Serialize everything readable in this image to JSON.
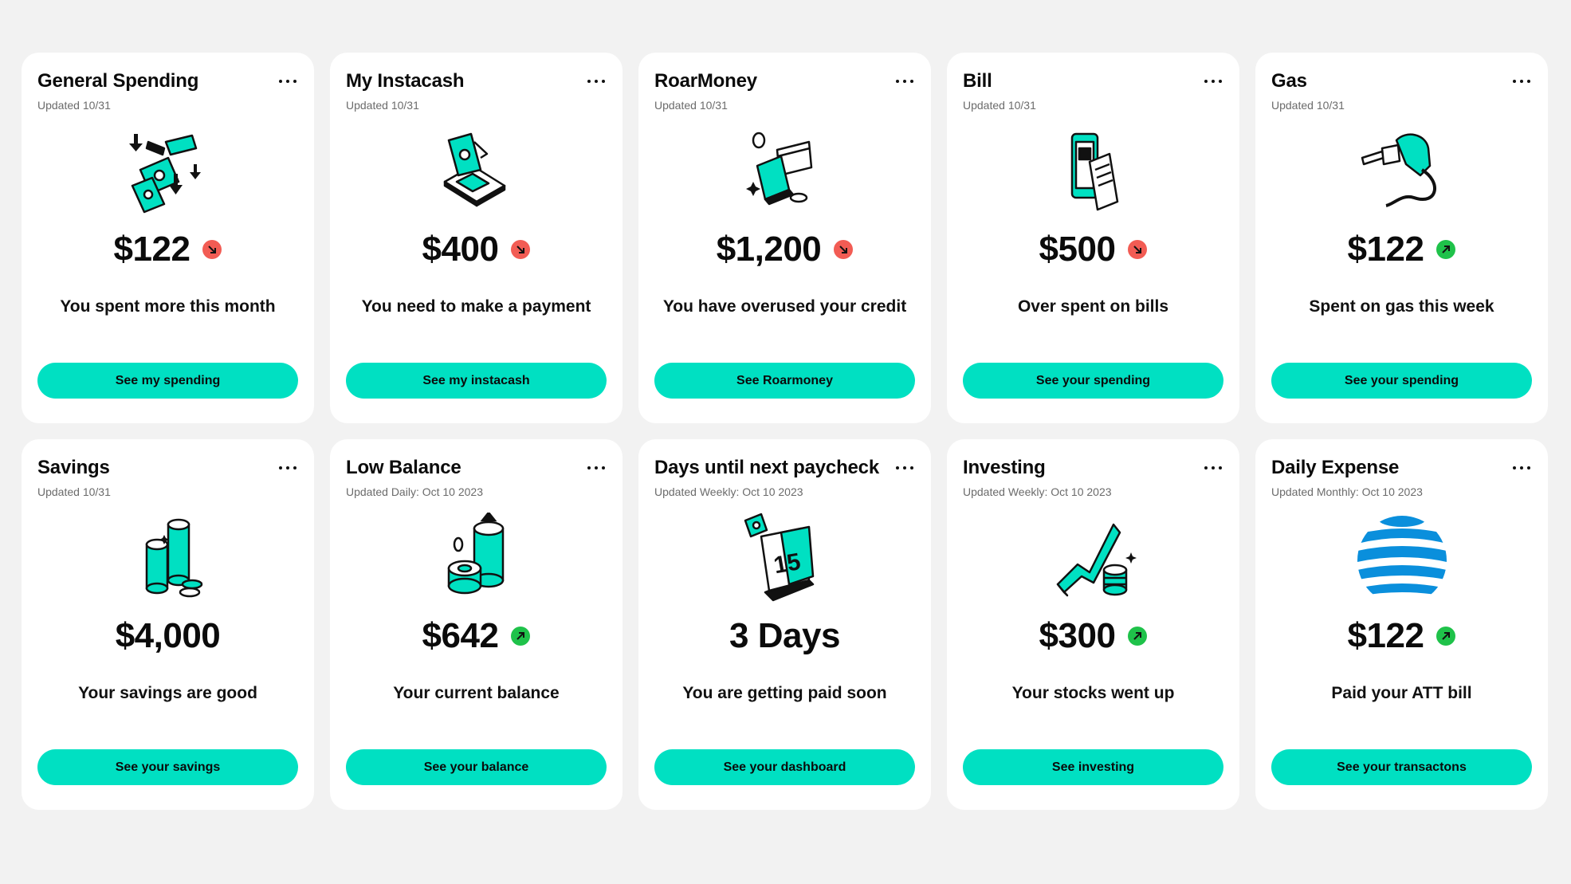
{
  "colors": {
    "accent": "#00e0c2",
    "trend_down": "#f25c54",
    "trend_up": "#1fc24a",
    "background": "#f2f2f2",
    "card": "#ffffff"
  },
  "cards": [
    {
      "title": "General Spending",
      "updated": "Updated 10/31",
      "amount": "$122",
      "trend": "down",
      "description": "You spent more this month",
      "button": "See my spending",
      "icon": "falling-money-icon"
    },
    {
      "title": "My Instacash",
      "updated": "Updated 10/31",
      "amount": "$400",
      "trend": "down",
      "description": "You need to make a payment",
      "button": "See my instacash",
      "icon": "phone-cash-icon"
    },
    {
      "title": "RoarMoney",
      "updated": "Updated 10/31",
      "amount": "$1,200",
      "trend": "down",
      "description": "You have overused your credit",
      "button": "See Roarmoney",
      "icon": "wallet-card-icon"
    },
    {
      "title": "Bill",
      "updated": "Updated 10/31",
      "amount": "$500",
      "trend": "down",
      "description": "Over spent on bills",
      "button": "See your spending",
      "icon": "phone-receipt-icon"
    },
    {
      "title": "Gas",
      "updated": "Updated 10/31",
      "amount": "$122",
      "trend": "up",
      "description": "Spent on gas this week",
      "button": "See your spending",
      "icon": "gas-nozzle-icon"
    },
    {
      "title": "Savings",
      "updated": "Updated 10/31",
      "amount": "$4,000",
      "trend": "none",
      "description": "Your savings are good",
      "button": "See your savings",
      "icon": "coin-stacks-icon"
    },
    {
      "title": "Low Balance",
      "updated": "Updated Daily: Oct 10 2023",
      "amount": "$642",
      "trend": "up",
      "description": "Your current balance",
      "button": "See your balance",
      "icon": "coin-cylinder-icon"
    },
    {
      "title": "Days until next paycheck",
      "updated": "Updated Weekly: Oct 10 2023",
      "amount": "3 Days",
      "trend": "none",
      "description": "You are getting paid soon",
      "button": "See your dashboard",
      "icon": "calendar-icon"
    },
    {
      "title": "Investing",
      "updated": "Updated Weekly: Oct 10 2023",
      "amount": "$300",
      "trend": "up",
      "description": "Your stocks went up",
      "button": "See investing",
      "icon": "stock-chart-icon"
    },
    {
      "title": "Daily Expense",
      "updated": "Updated Monthly: Oct 10 2023",
      "amount": "$122",
      "trend": "up",
      "description": "Paid your ATT bill",
      "button": "See your transactons",
      "icon": "att-globe-icon"
    }
  ]
}
